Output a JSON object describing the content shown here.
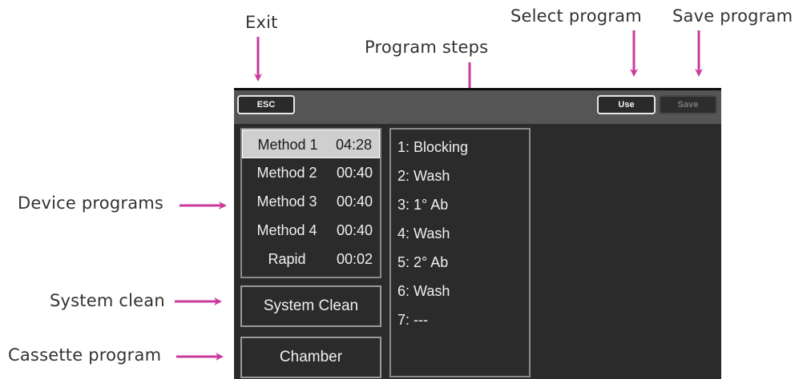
{
  "callouts": {
    "exit": "Exit",
    "program_steps": "Program steps",
    "select_program": "Select program",
    "save_program": "Save program",
    "device_programs": "Device programs",
    "system_clean": "System clean",
    "cassette_program": "Cassette program"
  },
  "colors": {
    "arrow": "#c93a9c",
    "screen_bg": "#2b2b2b",
    "toolbar_bg": "#555555",
    "selected_bg": "#cfcfcf"
  },
  "toolbar": {
    "esc_label": "ESC",
    "use_label": "Use",
    "save_label": "Save"
  },
  "programs": [
    {
      "name": "Method 1",
      "time": "04:28",
      "selected": true
    },
    {
      "name": "Method 2",
      "time": "00:40",
      "selected": false
    },
    {
      "name": "Method 3",
      "time": "00:40",
      "selected": false
    },
    {
      "name": "Method 4",
      "time": "00:40",
      "selected": false
    },
    {
      "name": "Rapid",
      "time": "00:02",
      "selected": false
    }
  ],
  "buttons": {
    "system_clean": "System Clean",
    "chamber": "Chamber"
  },
  "steps": [
    "1: Blocking",
    "2: Wash",
    "3: 1° Ab",
    "4: Wash",
    "5: 2° Ab",
    "6: Wash",
    "7: ---"
  ]
}
